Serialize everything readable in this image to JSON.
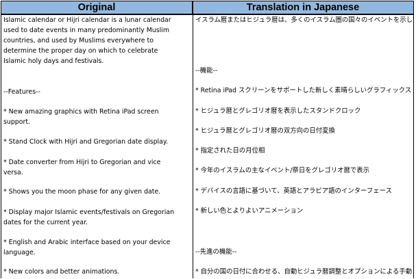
{
  "headers": {
    "original": "Original",
    "translation": "Translation in Japanese"
  },
  "original": [
    "Islamic calendar or Hijri calendar is a lunar calendar\nused to date events in many predominantly Muslim\ncountries, and used by Muslims everywhere to\ndetermine the proper day on which to celebrate\nIslamic holy days and festivals.",
    "--Features--",
    "* New amazing graphics with Retina iPad screen\nsupport.",
    "* Stand Clock with Hijri and Gregorian date display.",
    "* Date converter from Hijri to Gregorian and vice\nversa.",
    "* Shows you the moon phase for any given date.",
    "* Display major Islamic events/festivals on Gregorian\ndates for the current year.",
    "* English and Arabic interface based on your device\nlanguage.",
    "* New colors and better animations."
  ],
  "translation": [
    "イスラム暦またはヒジュラ暦は、多くのイスラム圏の国々のイベントを示している太\n陰暦で、イスラム教徒の人々が祭事を行う神聖なる日や祝日など、正確な日\nを決定するために利用されています。",
    "--機能--",
    "* Retina iPad スクリーンをサポートした新しく素晴らしいグラフィックス",
    "* ヒジュラ暦とグレゴリオ暦を表示したスタンドクロック",
    "* ヒジュラ暦とグレゴリオ暦の双方向の日付変換",
    "* 指定された日の月位相",
    "* 今年のイスラムの主なイベント/祭日をグレゴリオ暦で表示",
    "* デバイスの言語に基づいて、英語とアラビア語のインターフェース",
    "* 新しい色とよりよいアニメーション",
    "--先進の機能--",
    "* 自分の国の日付に合わせる、自動ヒジュラ暦調整とオプションによる手動ヒ"
  ]
}
